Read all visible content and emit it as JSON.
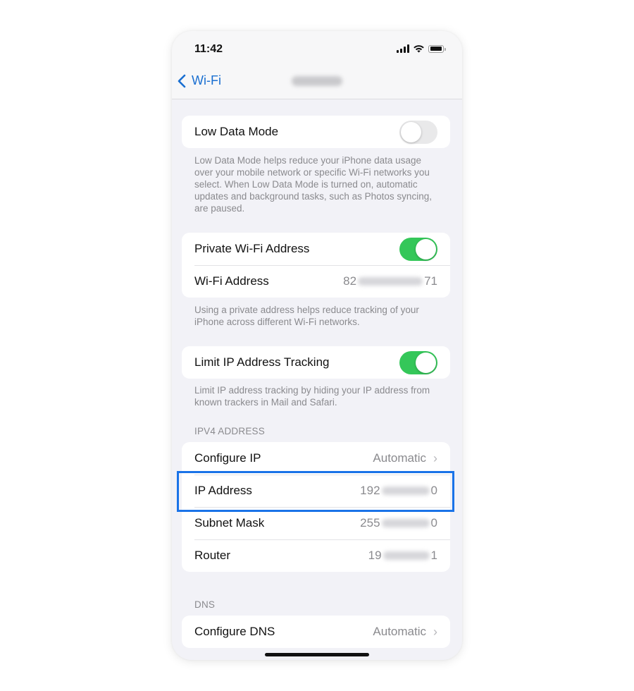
{
  "status_bar": {
    "time": "11:42",
    "icons": [
      "cellular-signal-icon",
      "wifi-icon",
      "battery-icon"
    ]
  },
  "nav": {
    "back_label": "Wi-Fi",
    "back_icon": "chevron-left-icon",
    "title": "(blurred network name)"
  },
  "low_data": {
    "label": "Low Data Mode",
    "enabled": false,
    "footer": "Low Data Mode helps reduce your iPhone data usage over your mobile network or specific Wi-Fi networks you select. When Low Data Mode is turned on, automatic updates and background tasks, such as Photos syncing, are paused."
  },
  "private_address": {
    "toggle_label": "Private Wi-Fi Address",
    "enabled": true,
    "address_label": "Wi-Fi Address",
    "address_prefix": "82",
    "address_suffix": "71",
    "footer": "Using a private address helps reduce tracking of your iPhone across different Wi-Fi networks."
  },
  "limit_tracking": {
    "label": "Limit IP Address Tracking",
    "enabled": true,
    "footer": "Limit IP address tracking by hiding your IP address from known trackers in Mail and Safari."
  },
  "ipv4": {
    "header": "IPV4 ADDRESS",
    "rows": [
      {
        "label": "Configure IP",
        "value": "Automatic",
        "chevron": true
      },
      {
        "label": "IP Address",
        "value_prefix": "192",
        "value_suffix": "0",
        "highlighted": true
      },
      {
        "label": "Subnet Mask",
        "value_prefix": "255",
        "value_suffix": "0"
      },
      {
        "label": "Router",
        "value_prefix": "19",
        "value_suffix": "1"
      }
    ]
  },
  "dns": {
    "header": "DNS",
    "rows": [
      {
        "label": "Configure DNS",
        "value": "Automatic",
        "chevron": true
      }
    ]
  },
  "colors": {
    "accent": "#1a6fd1",
    "toggle_on": "#34c759",
    "highlight_border": "#1a73e8",
    "background": "#f2f2f7"
  }
}
